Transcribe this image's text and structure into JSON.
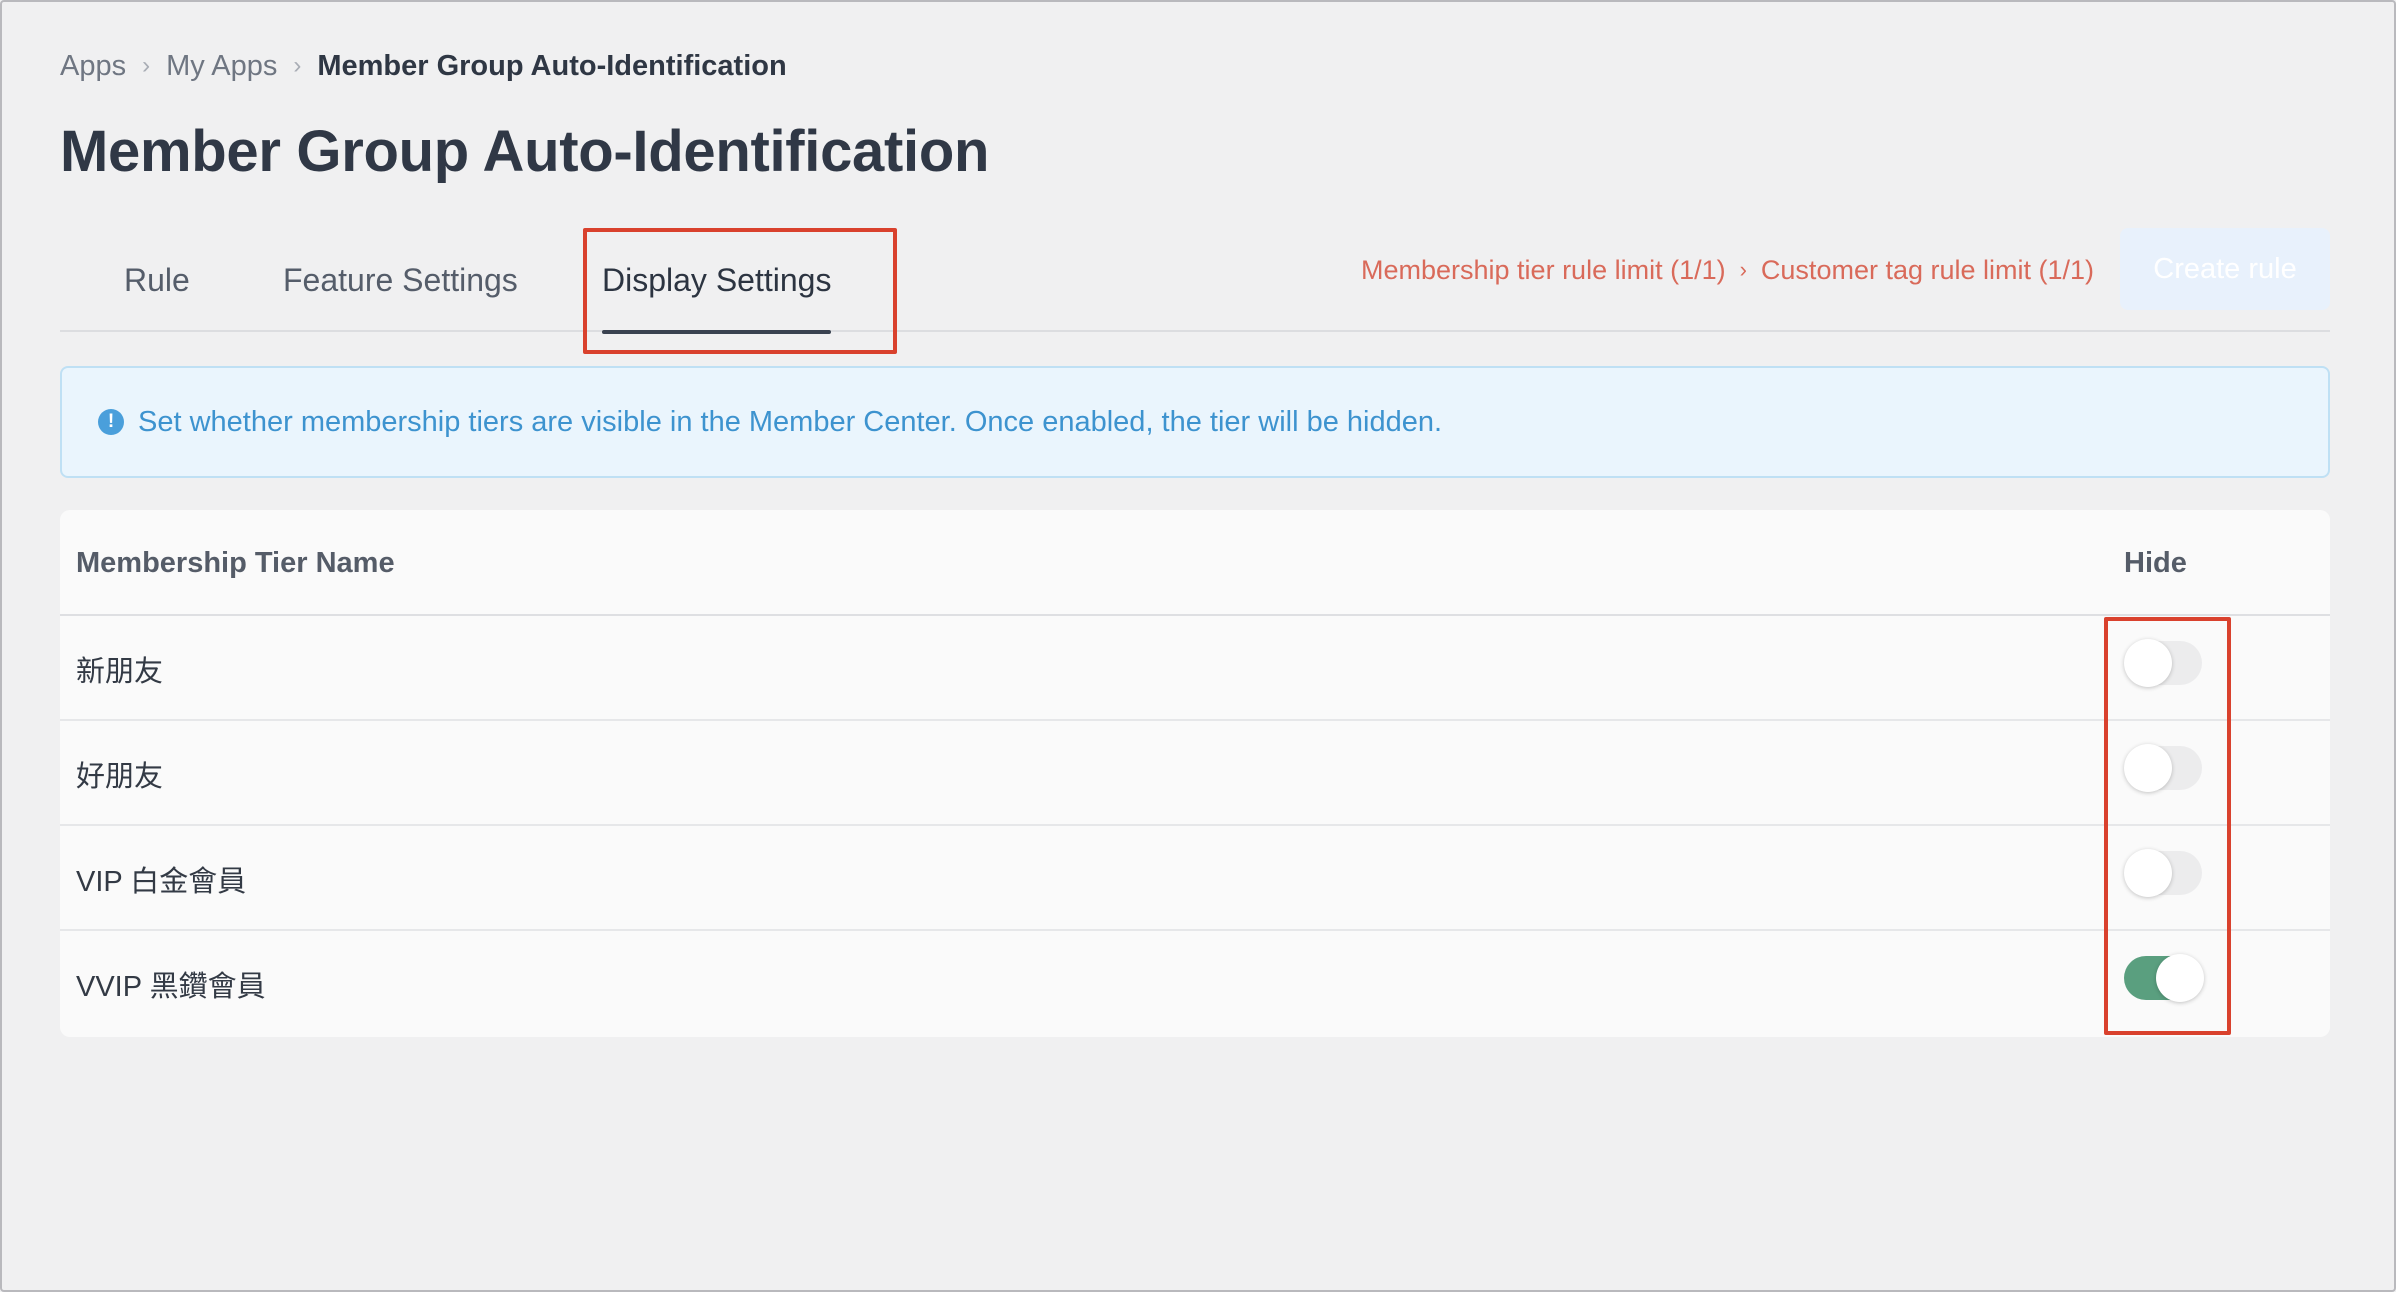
{
  "breadcrumb": {
    "items": [
      "Apps",
      "My Apps"
    ],
    "current": "Member Group Auto-Identification"
  },
  "page_title": "Member Group Auto-Identification",
  "tabs": [
    {
      "label": "Rule",
      "active": false
    },
    {
      "label": "Feature Settings",
      "active": false
    },
    {
      "label": "Display Settings",
      "active": true
    }
  ],
  "limits": {
    "membership": "Membership tier rule limit (1/1)",
    "separator": "›",
    "customer_tag": "Customer tag rule limit (1/1)"
  },
  "create_button": "Create rule",
  "info": {
    "icon": "info-icon",
    "icon_glyph": "!",
    "text": "Set whether membership tiers are visible in the Member Center. Once enabled, the tier will be hidden."
  },
  "table": {
    "headers": {
      "name": "Membership Tier Name",
      "hide": "Hide"
    },
    "rows": [
      {
        "name": "新朋友",
        "hidden": false
      },
      {
        "name": "好朋友",
        "hidden": false
      },
      {
        "name": "VIP 白金會員",
        "hidden": false
      },
      {
        "name": "VVIP 黑鑽會員",
        "hidden": true
      }
    ]
  },
  "colors": {
    "highlight": "#d9412d",
    "toggle_on": "#5a9f7f",
    "info_text": "#3d93cf",
    "limit_text": "#d96a5a"
  }
}
